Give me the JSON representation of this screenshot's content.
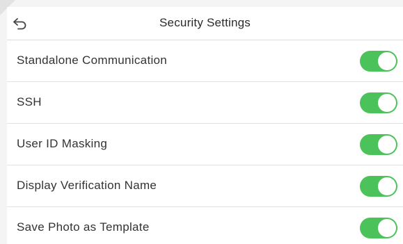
{
  "header": {
    "title": "Security Settings",
    "back_icon": "back-arrow-icon"
  },
  "colors": {
    "toggle_on": "#4bc35a",
    "toggle_off": "#cfcfcf",
    "divider": "#e2e2e2"
  },
  "settings": [
    {
      "label": "Standalone Communication",
      "enabled": true
    },
    {
      "label": "SSH",
      "enabled": true
    },
    {
      "label": "User ID Masking",
      "enabled": true
    },
    {
      "label": "Display Verification Name",
      "enabled": true
    },
    {
      "label": "Save Photo as Template",
      "enabled": true
    }
  ]
}
